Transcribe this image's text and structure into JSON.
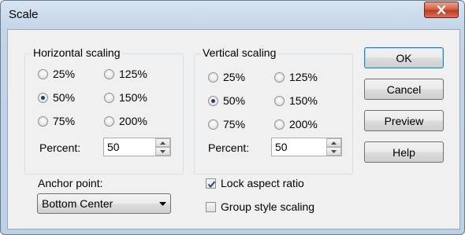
{
  "window": {
    "title": "Scale"
  },
  "horizontal": {
    "title": "Horizontal scaling",
    "options": [
      "25%",
      "125%",
      "50%",
      "150%",
      "75%",
      "200%"
    ],
    "selected": "50%",
    "percent_label": "Percent:",
    "percent_value": "50"
  },
  "vertical": {
    "title": "Vertical scaling",
    "options": [
      "25%",
      "125%",
      "50%",
      "150%",
      "75%",
      "200%"
    ],
    "selected": "50%",
    "percent_label": "Percent:",
    "percent_value": "50"
  },
  "anchor": {
    "label": "Anchor point:",
    "value": "Bottom Center"
  },
  "checks": {
    "lock": {
      "label": "Lock aspect ratio",
      "checked": true
    },
    "group": {
      "label": "Group style scaling",
      "checked": false
    }
  },
  "buttons": {
    "ok": "OK",
    "cancel": "Cancel",
    "preview": "Preview",
    "help": "Help"
  },
  "icons": {
    "close": "close-icon",
    "radio_checked": "radio-checked-icon",
    "spin_up": "spin-up-icon",
    "spin_down": "spin-down-icon",
    "dropdown": "chevron-down-icon",
    "check": "checkmark-icon"
  },
  "colors": {
    "close_button": "#c23b22",
    "accent_default_button": "#3c7fb1"
  }
}
